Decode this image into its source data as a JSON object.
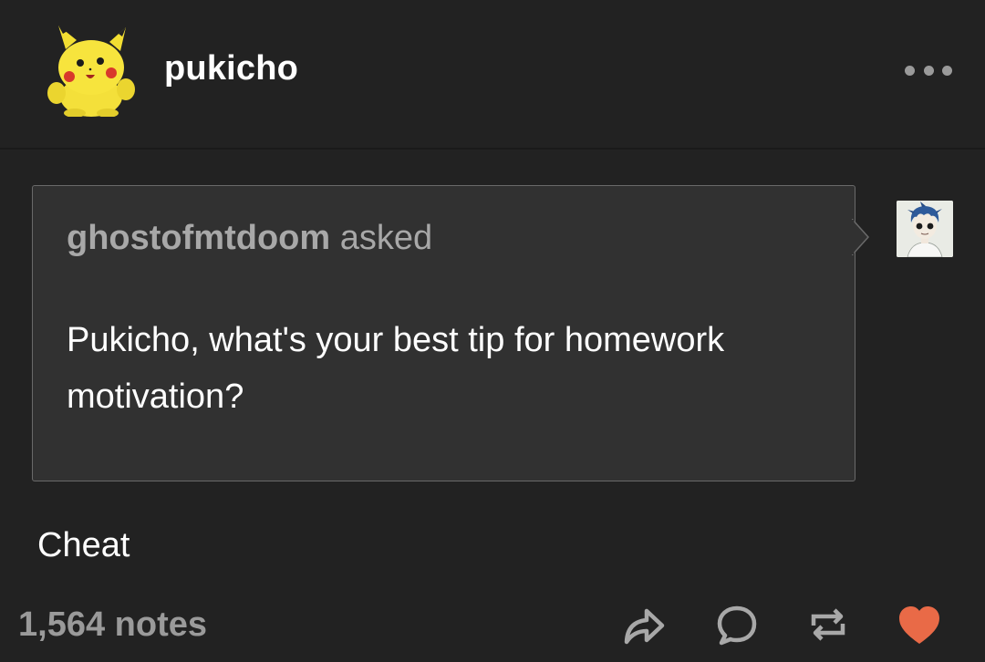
{
  "post": {
    "blog_name": "pukicho",
    "avatar_icon": "pikachu-plush-avatar",
    "more_icon": "more-options-icon"
  },
  "ask": {
    "asker_name": "ghostofmtdoom",
    "asked_label": "asked",
    "question": "Pukicho, what's your best tip for homework motivation?",
    "asker_avatar_icon": "blue-haired-character-avatar"
  },
  "answer": {
    "text": "Cheat"
  },
  "footer": {
    "notes": "1,564 notes",
    "actions": [
      "share-icon",
      "reply-icon",
      "reblog-icon",
      "like-heart-icon"
    ],
    "like_color": "#e96a47"
  },
  "colors": {
    "background": "#222222",
    "ask_background": "#313131",
    "muted_text": "#9a9a9a"
  }
}
